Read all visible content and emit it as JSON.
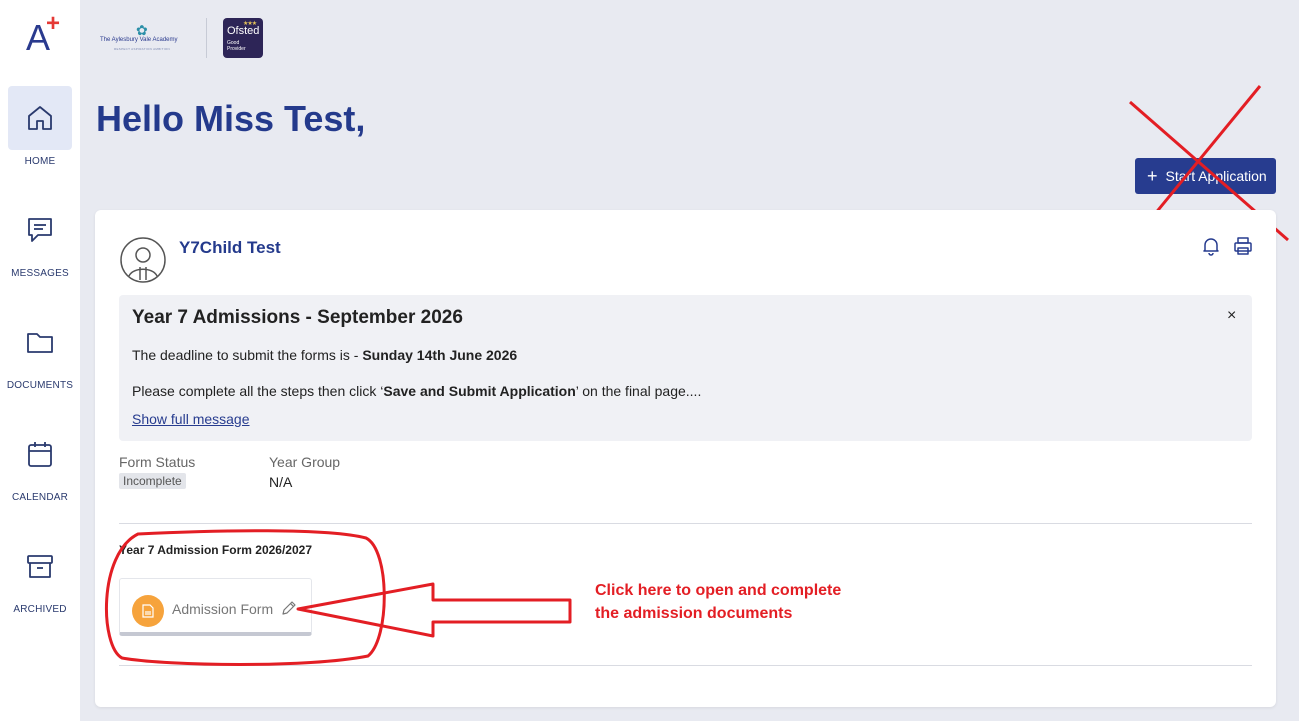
{
  "app": {
    "logo_letter": "A",
    "logo_plus": "+"
  },
  "sidebar": {
    "items": [
      {
        "label": "HOME",
        "icon": "home-icon",
        "active": true
      },
      {
        "label": "MESSAGES",
        "icon": "message-icon",
        "active": false
      },
      {
        "label": "DOCUMENTS",
        "icon": "folder-icon",
        "active": false
      },
      {
        "label": "CALENDAR",
        "icon": "calendar-icon",
        "active": false
      },
      {
        "label": "ARCHIVED",
        "icon": "archive-icon",
        "active": false
      }
    ]
  },
  "header": {
    "school_name": "The Aylesbury Vale Academy",
    "school_tagline": "RESPECT ASPIRATION AMBITION",
    "ofsted_name": "Ofsted",
    "ofsted_rating_line1": "Good",
    "ofsted_rating_line2": "Provider",
    "greeting": "Hello Miss Test,",
    "start_application_label": "Start Application"
  },
  "card": {
    "child_name": "Y7Child Test",
    "message": {
      "title": "Year 7 Admissions - September 2026",
      "deadline_prefix": "The deadline to submit the forms is - ",
      "deadline_date": "Sunday 14th June 2026",
      "steps_prefix": "Please complete all the steps then click ‘",
      "steps_bold": "Save and Submit Application",
      "steps_suffix": "’ on the final page....",
      "show_full": "Show full message",
      "close_symbol": "×"
    },
    "form_status_label": "Form Status",
    "form_status_value": "Incomplete",
    "year_group_label": "Year Group",
    "year_group_value": "N/A",
    "form_section_title": "Year 7 Admission Form 2026/2027",
    "form_tile_label": "Admission Form"
  },
  "annotation": {
    "line1": "Click here to open and complete",
    "line2": "the admission documents",
    "color": "#e31e24"
  },
  "colors": {
    "brand": "#273c8f",
    "background": "#e8eaf1",
    "doc_circle": "#f6a33c"
  }
}
